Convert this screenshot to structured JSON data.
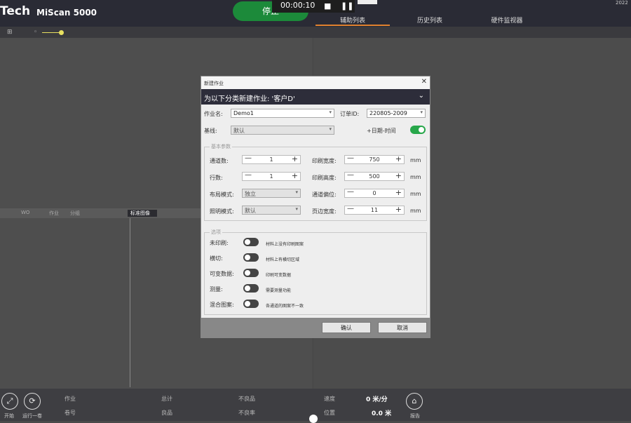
{
  "header": {
    "brand": "Tech",
    "product": "MiScan 5000",
    "stop_button": "停止",
    "timer": "00:00:10",
    "corner_text": "2022",
    "tabs": [
      {
        "label": "辅助列表",
        "active": true
      },
      {
        "label": "历史列表",
        "active": false
      },
      {
        "label": "硬件监视器",
        "active": false
      }
    ],
    "accent_color": "#e0812e"
  },
  "toolbar": {
    "icon_left": "grid-icon",
    "icon_mid": "zoom-icon"
  },
  "left_subtabs": [
    "WO",
    "作业",
    "分组",
    "标准图像"
  ],
  "dialog": {
    "window_title": "新建作业",
    "header": "为以下分类新建作业: '客户D'",
    "job_name_label": "作业名:",
    "job_name_value": "Demo1",
    "order_id_label": "订单ID:",
    "order_id_value": "220805-2009",
    "baseline_label": "基线:",
    "baseline_value": "默认",
    "date_time_label": "+日期-时间",
    "basic_group": "基本参数",
    "rows_label": "通道数:",
    "rows_value": "1",
    "cols_label": "行数:",
    "cols_value": "1",
    "layout_label": "布局模式:",
    "layout_value": "独立",
    "light_label": "照明模式:",
    "light_value": "默认",
    "print_width_label": "印刷宽度:",
    "print_width_value": "750",
    "print_height_label": "印刷高度:",
    "print_height_value": "500",
    "offset_label": "通道偏位:",
    "offset_value": "0",
    "margin_label": "页边宽度:",
    "margin_value": "11",
    "unit": "mm",
    "options_group": "选项",
    "options": [
      {
        "label": "未印刷:",
        "hint": "材料上没有印刷图案",
        "on": false
      },
      {
        "label": "横切:",
        "hint": "材料上有横切区域",
        "on": false
      },
      {
        "label": "可变数据:",
        "hint": "印刷可变数据",
        "on": false
      },
      {
        "label": "测量:",
        "hint": "需要测量功能",
        "on": false
      },
      {
        "label": "混合图案:",
        "hint": "各通道的图案不一致",
        "on": false
      }
    ],
    "ok_button": "确认",
    "cancel_button": "取消"
  },
  "bottombar": {
    "start_label": "开始",
    "print_one_label": "运行一卷",
    "review_label": "报告",
    "job_label": "作业",
    "roll_label": "卷号",
    "total_label": "总计",
    "good_label": "良品",
    "defect_label": "不良品",
    "defect_rate_label": "不良率",
    "speed_label": "速度",
    "position_label": "位置",
    "speed_value": "0 米/分",
    "position_value": "0.0 米"
  }
}
